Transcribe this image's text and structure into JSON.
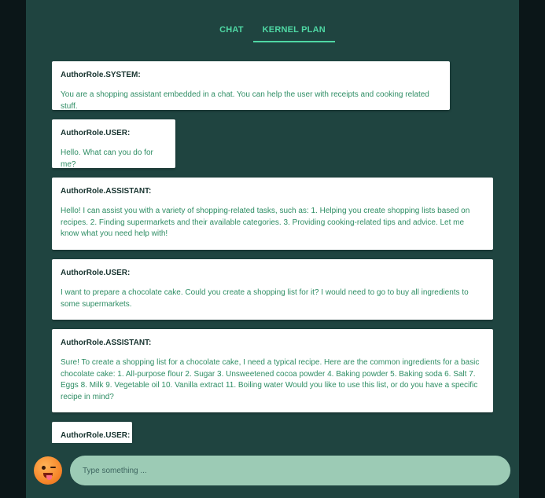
{
  "tabs": [
    {
      "label": "CHAT",
      "active": false
    },
    {
      "label": "KERNEL PLAN",
      "active": true
    }
  ],
  "messages": [
    {
      "author": "AuthorRole.SYSTEM:",
      "text": "You are a shopping assistant embedded in a chat. You can help the user with receipts and cooking related stuff."
    },
    {
      "author": "AuthorRole.USER:",
      "text": "Hello. What can you do for me?"
    },
    {
      "author": "AuthorRole.ASSISTANT:",
      "text": "Hello! I can assist you with a variety of shopping-related tasks, such as: 1. Helping you create shopping lists based on recipes. 2. Finding supermarkets and their available categories. 3. Providing cooking-related tips and advice. Let me know what you need help with!"
    },
    {
      "author": "AuthorRole.USER:",
      "text": "I want to prepare a chocolate cake. Could you create a shopping list for it? I would need to go to buy all ingredients to some supermarkets."
    },
    {
      "author": "AuthorRole.ASSISTANT:",
      "text": "Sure! To create a shopping list for a chocolate cake, I need a typical recipe. Here are the common ingredients for a basic chocolate cake: 1. All-purpose flour 2. Sugar 3. Unsweetened cocoa powder 4. Baking powder 5. Baking soda 6. Salt 7. Eggs 8. Milk 9. Vegetable oil 10. Vanilla extract 11. Boiling water Would you like to use this list, or do you have a specific recipe in mind?"
    },
    {
      "author": "AuthorRole.USER:",
      "text": ""
    }
  ],
  "input": {
    "placeholder": "Type something ..."
  },
  "colors": {
    "background": "#1f4440",
    "accent": "#4fd8a4",
    "input": "#9ccbb5"
  },
  "avatar": {
    "icon": "winking-tongue-emoji-icon"
  }
}
